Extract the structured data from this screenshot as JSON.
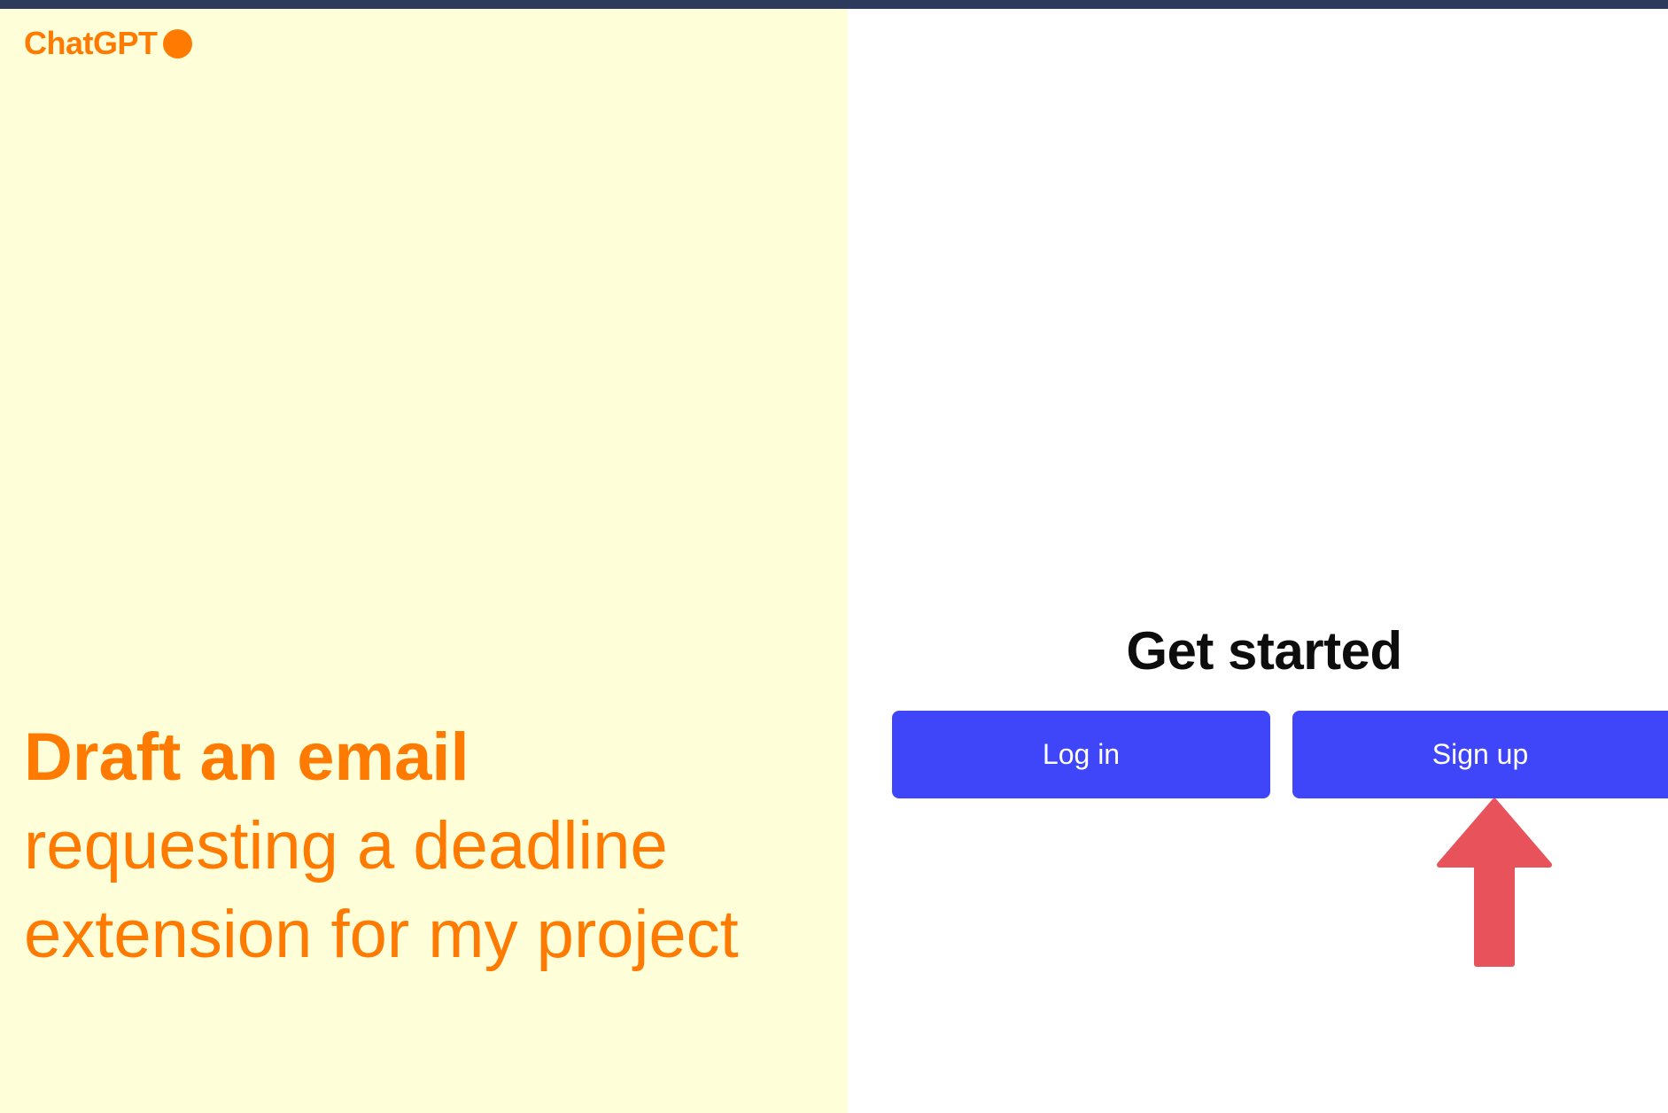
{
  "logo": {
    "text": "ChatGPT",
    "color": "#ff7a00"
  },
  "hero": {
    "headline_bold": "Draft an email",
    "headline_rest": "requesting a deadline extension for my project",
    "background": "#fefed9"
  },
  "auth": {
    "title": "Get started",
    "login_label": "Log in",
    "signup_label": "Sign up",
    "button_color": "#3f45f8"
  },
  "annotation": {
    "icon": "arrow-up-icon",
    "color": "#e8525a"
  }
}
